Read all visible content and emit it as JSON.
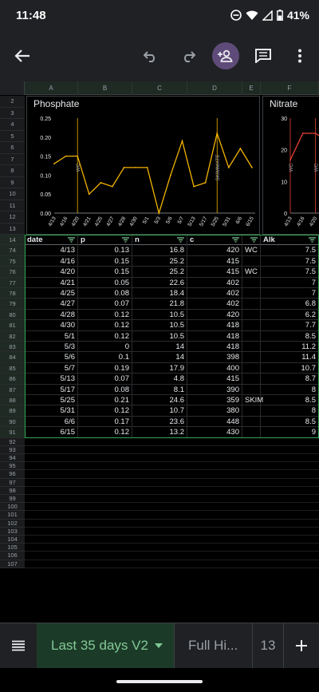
{
  "status_bar": {
    "time": "11:48",
    "battery": "41%"
  },
  "app_bar": {
    "back_icon": "arrow-left-icon",
    "undo_icon": "undo-icon",
    "redo_icon": "redo-icon",
    "share_icon": "person-add-icon",
    "comment_icon": "comment-icon",
    "more_icon": "more-vert-icon"
  },
  "columns": [
    "A",
    "B",
    "C",
    "D",
    "E",
    "F"
  ],
  "chart_rows": [
    "2",
    "3",
    "4",
    "5",
    "6",
    "7",
    "8",
    "9",
    "10",
    "11",
    "12",
    "13"
  ],
  "chart_data": [
    {
      "type": "line",
      "title": "Phosphate",
      "categories": [
        "4/13",
        "4/16",
        "4/20",
        "4/21",
        "4/25",
        "4/27",
        "4/28",
        "4/30",
        "5/1",
        "5/3",
        "5/6",
        "5/7",
        "5/13",
        "5/17",
        "5/25",
        "5/31",
        "6/6",
        "6/15"
      ],
      "series": [
        {
          "values": [
            0.13,
            0.15,
            0.15,
            0.05,
            0.08,
            0.07,
            0.12,
            0.12,
            0.12,
            0,
            0.1,
            0.19,
            0.07,
            0.08,
            0.21,
            0.12,
            0.17,
            0.12
          ]
        }
      ],
      "ylim": [
        0,
        0.25
      ],
      "yticks": [
        "0.25",
        "0.20",
        "0.15",
        "0.10",
        "0.05",
        "0.00"
      ],
      "annotations": [
        {
          "at": "4/20",
          "label": "WC"
        },
        {
          "at": "5/25",
          "label": "SKIMMATE"
        }
      ],
      "line_color": "#f4b400"
    },
    {
      "type": "line",
      "title": "Nitrate",
      "categories": [
        "4/13",
        "4/16",
        "4/20",
        "4/21"
      ],
      "series": [
        {
          "values": [
            16.8,
            25.2,
            25.2,
            22.6
          ]
        }
      ],
      "ylim": [
        0,
        30
      ],
      "yticks": [
        "30",
        "20",
        "10",
        "0"
      ],
      "annotations": [
        {
          "at": "4/13",
          "label": "WC"
        },
        {
          "at": "4/20",
          "label": "WC"
        }
      ],
      "line_color": "#ea4335"
    }
  ],
  "table": {
    "header_row_num": "14",
    "headers": [
      "date",
      "p",
      "n",
      "c",
      "",
      "Alk"
    ],
    "rows": [
      {
        "num": "74",
        "cells": [
          "4/13",
          "0.13",
          "16.8",
          "420",
          "WC",
          "7.5"
        ]
      },
      {
        "num": "75",
        "cells": [
          "4/16",
          "0.15",
          "25.2",
          "415",
          "",
          "7.5"
        ]
      },
      {
        "num": "76",
        "cells": [
          "4/20",
          "0.15",
          "25.2",
          "415",
          "WC",
          "7.5"
        ]
      },
      {
        "num": "77",
        "cells": [
          "4/21",
          "0.05",
          "22.6",
          "402",
          "",
          "7"
        ]
      },
      {
        "num": "78",
        "cells": [
          "4/25",
          "0.08",
          "18.4",
          "402",
          "",
          "7"
        ]
      },
      {
        "num": "79",
        "cells": [
          "4/27",
          "0.07",
          "21.8",
          "402",
          "",
          "6.8"
        ]
      },
      {
        "num": "80",
        "cells": [
          "4/28",
          "0.12",
          "10.5",
          "420",
          "",
          "6.2"
        ]
      },
      {
        "num": "81",
        "cells": [
          "4/30",
          "0.12",
          "10.5",
          "418",
          "",
          "7.7"
        ]
      },
      {
        "num": "82",
        "cells": [
          "5/1",
          "0.12",
          "10.5",
          "418",
          "",
          "8.5"
        ]
      },
      {
        "num": "83",
        "cells": [
          "5/3",
          "0",
          "14",
          "418",
          "",
          "11.2"
        ]
      },
      {
        "num": "84",
        "cells": [
          "5/6",
          "0.1",
          "14",
          "398",
          "",
          "11.4"
        ]
      },
      {
        "num": "85",
        "cells": [
          "5/7",
          "0.19",
          "17.9",
          "400",
          "",
          "10.7"
        ]
      },
      {
        "num": "86",
        "cells": [
          "5/13",
          "0.07",
          "4.8",
          "415",
          "",
          "8.7"
        ]
      },
      {
        "num": "87",
        "cells": [
          "5/17",
          "0.08",
          "8.1",
          "390",
          "",
          "8"
        ]
      },
      {
        "num": "88",
        "cells": [
          "5/25",
          "0.21",
          "24.6",
          "359",
          "SKIM",
          "8.5"
        ]
      },
      {
        "num": "89",
        "cells": [
          "5/31",
          "0.12",
          "10.7",
          "380",
          "",
          "8"
        ]
      },
      {
        "num": "90",
        "cells": [
          "6/6",
          "0.17",
          "23.6",
          "448",
          "",
          "8.5"
        ]
      },
      {
        "num": "91",
        "cells": [
          "6/15",
          "0.12",
          "13.2",
          "430",
          "",
          "9"
        ]
      }
    ],
    "empty_rows": [
      "92",
      "93",
      "94",
      "95",
      "96",
      "97",
      "98",
      "99",
      "100",
      "101",
      "102",
      "103",
      "104",
      "105",
      "106",
      "107"
    ]
  },
  "tabs": {
    "menu_icon": "sheets-list-icon",
    "active": "Last 35 days V2",
    "second": "Full Hi...",
    "third": "13",
    "add_icon": "plus-icon"
  }
}
